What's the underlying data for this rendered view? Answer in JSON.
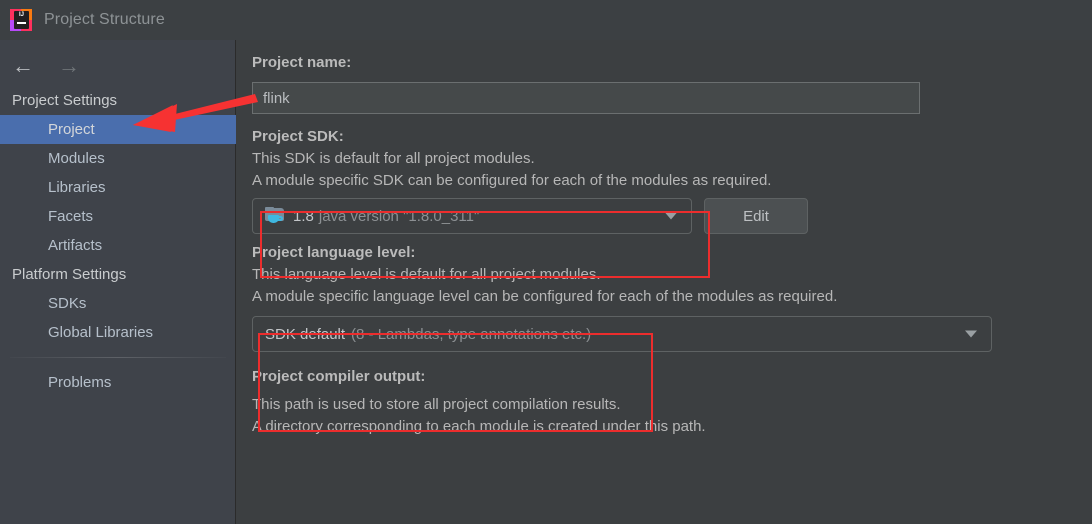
{
  "window": {
    "title": "Project Structure",
    "logo_icon": "intellij-idea-logo-icon",
    "logo_letters": "IJ"
  },
  "sidebar": {
    "nav": {
      "back_icon": "arrow-left-icon",
      "back_label": "←",
      "forward_icon": "arrow-right-icon",
      "forward_label": "→"
    },
    "groups": [
      {
        "label": "Project Settings",
        "items": [
          {
            "label": "Project",
            "selected": true
          },
          {
            "label": "Modules",
            "selected": false
          },
          {
            "label": "Libraries",
            "selected": false
          },
          {
            "label": "Facets",
            "selected": false
          },
          {
            "label": "Artifacts",
            "selected": false
          }
        ]
      },
      {
        "label": "Platform Settings",
        "items": [
          {
            "label": "SDKs",
            "selected": false
          },
          {
            "label": "Global Libraries",
            "selected": false
          }
        ]
      }
    ],
    "problems": {
      "label": "Problems"
    },
    "selected_color": "#4a6ead"
  },
  "main": {
    "project_name": {
      "label": "Project name:",
      "value": "flink"
    },
    "project_sdk": {
      "label": "Project SDK:",
      "description_line1": "This SDK is default for all project modules.",
      "description_line2": "A module specific SDK can be configured for each of the modules as required.",
      "combo": {
        "icon": "java-sdk-folder-icon",
        "value": "1.8",
        "detail": "java version \"1.8.0_311\"",
        "caret_icon": "chevron-down-icon"
      },
      "edit_button": "Edit"
    },
    "project_language_level": {
      "label": "Project language level:",
      "description_line1": "This language level is default for all project modules.",
      "description_line2": "A module specific language level can be configured for each of the modules as required.",
      "combo": {
        "value": "SDK default",
        "detail": "(8 - Lambdas, type annotations etc.)",
        "caret_icon": "chevron-down-icon"
      }
    },
    "project_compiler_output": {
      "label": "Project compiler output:",
      "description_line1": "This path is used to store all project compilation results.",
      "description_line2": "A directory corresponding to each module is created under this path."
    }
  },
  "annotations": {
    "color": "#ec2d2d",
    "arrow_icon": "red-arrow-pointer",
    "rect_sdk_label": "highlight-project-sdk",
    "rect_language_label": "highlight-project-language-level"
  }
}
